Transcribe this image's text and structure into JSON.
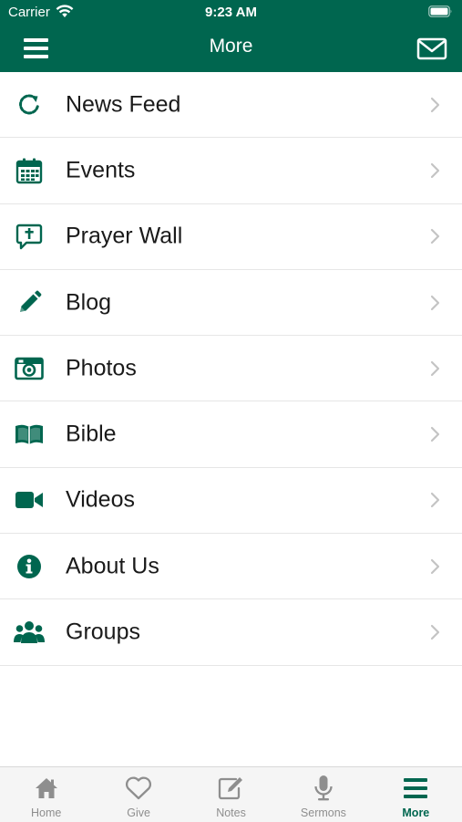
{
  "status_bar": {
    "carrier": "Carrier",
    "time": "9:23 AM"
  },
  "header": {
    "title": "More",
    "left_icon": "hamburger-menu-icon",
    "right_icon": "envelope-icon"
  },
  "colors": {
    "brand": "#00664f",
    "tab_inactive": "#8e8e8e",
    "chevron": "#c4c4c4"
  },
  "menu": {
    "items": [
      {
        "label": "News Feed",
        "icon": "refresh-icon"
      },
      {
        "label": "Events",
        "icon": "calendar-icon"
      },
      {
        "label": "Prayer Wall",
        "icon": "prayer-bubble-icon"
      },
      {
        "label": "Blog",
        "icon": "pencil-icon"
      },
      {
        "label": "Photos",
        "icon": "camera-icon"
      },
      {
        "label": "Bible",
        "icon": "book-icon"
      },
      {
        "label": "Videos",
        "icon": "video-camera-icon"
      },
      {
        "label": "About Us",
        "icon": "info-icon"
      },
      {
        "label": "Groups",
        "icon": "users-icon"
      }
    ]
  },
  "tab_bar": {
    "tabs": [
      {
        "label": "Home",
        "icon": "home-icon",
        "active": false
      },
      {
        "label": "Give",
        "icon": "heart-icon",
        "active": false
      },
      {
        "label": "Notes",
        "icon": "notes-icon",
        "active": false
      },
      {
        "label": "Sermons",
        "icon": "microphone-icon",
        "active": false
      },
      {
        "label": "More",
        "icon": "more-menu-icon",
        "active": true
      }
    ]
  }
}
